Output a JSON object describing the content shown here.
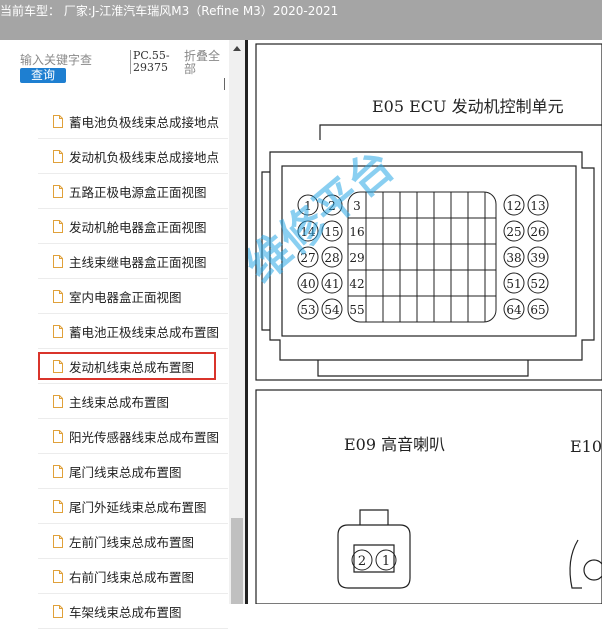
{
  "title": "当前车型： 厂家:J-江淮汽车瑞风M3（Refine M3）2020-2021",
  "sidebar": {
    "search_placeholder": "输入关键字查",
    "search_button": "查询",
    "pc_code": "PC.55-29375",
    "collapse_all": "折叠全部",
    "items": [
      {
        "label": "蓄电池负极线束总成接地点"
      },
      {
        "label": "发动机负极线束总成接地点"
      },
      {
        "label": "五路正极电源盒正面视图"
      },
      {
        "label": "发动机舱电器盒正面视图"
      },
      {
        "label": "主线束继电器盒正面视图"
      },
      {
        "label": "室内电器盒正面视图"
      },
      {
        "label": "蓄电池正极线束总成布置图"
      },
      {
        "label": "发动机线束总成布置图",
        "selected": true
      },
      {
        "label": "主线束总成布置图"
      },
      {
        "label": "阳光传感器线束总成布置图"
      },
      {
        "label": "尾门线束总成布置图"
      },
      {
        "label": "尾门外延线束总成布置图"
      },
      {
        "label": "左前门线束总成布置图"
      },
      {
        "label": "右前门线束总成布置图"
      },
      {
        "label": "车架线束总成布置图"
      }
    ]
  },
  "diagram": {
    "e05_title": "E05 ECU 发动机控制单元",
    "e09_title": "E09 高音喇叭",
    "e10_title": "E10",
    "watermark": "维修平台",
    "ecu_pins": {
      "r1a": "1",
      "r1b": "2",
      "r1c": "3",
      "r1d": "12",
      "r1e": "13",
      "r2a": "14",
      "r2b": "15",
      "r2c": "16",
      "r2d": "25",
      "r2e": "26",
      "r3a": "27",
      "r3b": "28",
      "r3c": "29",
      "r3d": "38",
      "r3e": "39",
      "r4a": "40",
      "r4b": "41",
      "r4c": "42",
      "r4d": "51",
      "r4e": "52",
      "r5a": "53",
      "r5b": "54",
      "r5c": "55",
      "r5d": "64",
      "r5e": "65"
    },
    "horn_pins": {
      "p2": "2",
      "p1": "1"
    }
  },
  "colors": {
    "titlebar": "#a5a5a5",
    "button": "#1e7fd1",
    "selection": "#d9342b",
    "watermark": "#2aa7e6"
  }
}
